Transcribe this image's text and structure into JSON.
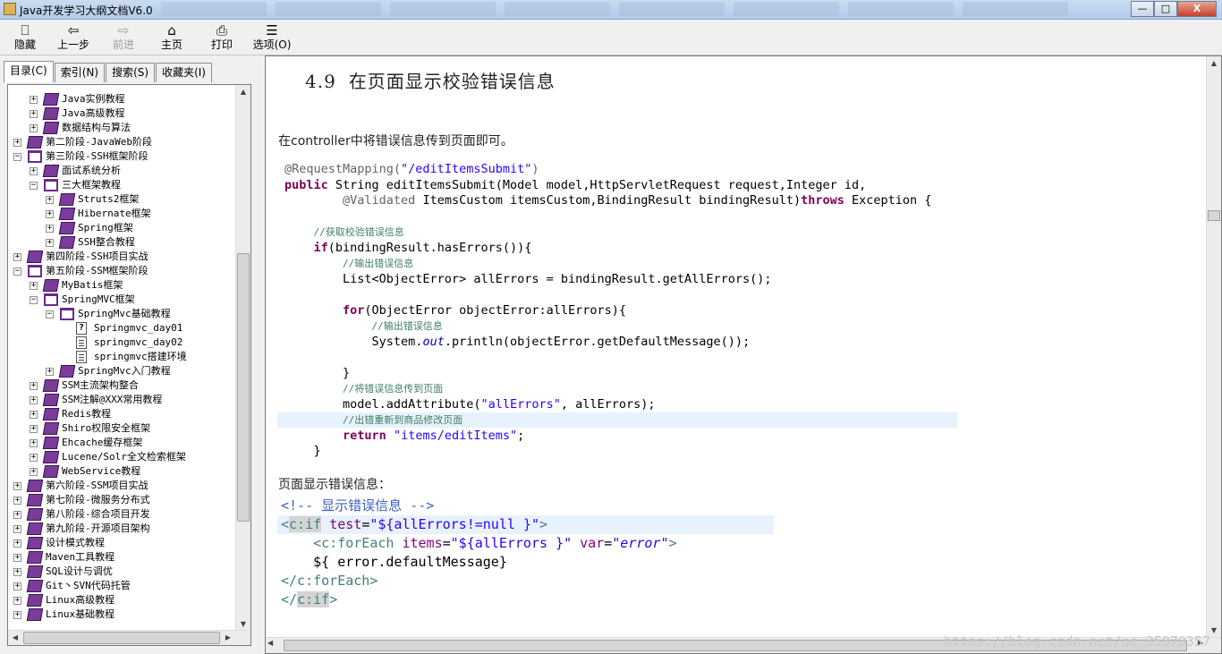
{
  "window": {
    "title": "Java开发学习大纲文档V6.0",
    "buttons": {
      "minimize": "—",
      "maximize": "□",
      "close": "X"
    }
  },
  "toolbar": {
    "items": [
      {
        "label": "隐藏",
        "icon": "hide-icon",
        "glyph": "⎕",
        "enabled": true
      },
      {
        "label": "上一步",
        "icon": "back-arrow-icon",
        "glyph": "⇦",
        "enabled": true
      },
      {
        "label": "前进",
        "icon": "forward-arrow-icon",
        "glyph": "⇨",
        "enabled": false
      },
      {
        "label": "主页",
        "icon": "home-icon",
        "glyph": "⌂",
        "enabled": true
      },
      {
        "label": "打印",
        "icon": "printer-icon",
        "glyph": "⎙",
        "enabled": true
      },
      {
        "label": "选项(O)",
        "icon": "options-icon",
        "glyph": "☰",
        "enabled": true
      }
    ]
  },
  "nav_tabs": [
    {
      "label": "目录(C)",
      "active": true
    },
    {
      "label": "索引(N)",
      "active": false
    },
    {
      "label": "搜索(S)",
      "active": false
    },
    {
      "label": "收藏夹(I)",
      "active": false
    }
  ],
  "tree": [
    {
      "label": "Java实例教程",
      "level": 1,
      "state": "collapsed",
      "icon": "closed-book-icon"
    },
    {
      "label": "Java高级教程",
      "level": 1,
      "state": "collapsed",
      "icon": "closed-book-icon"
    },
    {
      "label": "数据结构与算法",
      "level": 1,
      "state": "collapsed",
      "icon": "closed-book-icon"
    },
    {
      "label": "第二阶段-JavaWeb阶段",
      "level": 0,
      "state": "collapsed",
      "icon": "closed-book-icon"
    },
    {
      "label": "第三阶段-SSH框架阶段",
      "level": 0,
      "state": "expanded",
      "icon": "open-book-icon"
    },
    {
      "label": "面试系统分析",
      "level": 1,
      "state": "collapsed",
      "icon": "closed-book-icon"
    },
    {
      "label": "三大框架教程",
      "level": 1,
      "state": "expanded",
      "icon": "open-book-icon"
    },
    {
      "label": "Struts2框架",
      "level": 2,
      "state": "collapsed",
      "icon": "closed-book-icon"
    },
    {
      "label": "Hibernate框架",
      "level": 2,
      "state": "collapsed",
      "icon": "closed-book-icon"
    },
    {
      "label": "Spring框架",
      "level": 2,
      "state": "collapsed",
      "icon": "closed-book-icon"
    },
    {
      "label": "SSH整合教程",
      "level": 2,
      "state": "collapsed",
      "icon": "closed-book-icon"
    },
    {
      "label": "第四阶段-SSH项目实战",
      "level": 0,
      "state": "collapsed",
      "icon": "closed-book-icon"
    },
    {
      "label": "第五阶段-SSM框架阶段",
      "level": 0,
      "state": "expanded",
      "icon": "open-book-icon"
    },
    {
      "label": "MyBatis框架",
      "level": 1,
      "state": "collapsed",
      "icon": "closed-book-icon"
    },
    {
      "label": "SpringMVC框架",
      "level": 1,
      "state": "expanded",
      "icon": "open-book-icon"
    },
    {
      "label": "SpringMvc基础教程",
      "level": 2,
      "state": "expanded",
      "icon": "open-book-icon"
    },
    {
      "label": "Springmvc_day01",
      "level": 3,
      "state": "leaf",
      "icon": "help-page-icon"
    },
    {
      "label": "springmvc_day02",
      "level": 3,
      "state": "leaf",
      "icon": "page-icon"
    },
    {
      "label": "springmvc搭建环境",
      "level": 3,
      "state": "leaf",
      "icon": "page-icon"
    },
    {
      "label": "SpringMvc入门教程",
      "level": 2,
      "state": "collapsed",
      "icon": "closed-book-icon"
    },
    {
      "label": "SSM主流架构整合",
      "level": 1,
      "state": "collapsed",
      "icon": "closed-book-icon"
    },
    {
      "label": "SSM注解@XXX常用教程",
      "level": 1,
      "state": "collapsed",
      "icon": "closed-book-icon"
    },
    {
      "label": "Redis教程",
      "level": 1,
      "state": "collapsed",
      "icon": "closed-book-icon"
    },
    {
      "label": "Shiro权限安全框架",
      "level": 1,
      "state": "collapsed",
      "icon": "closed-book-icon"
    },
    {
      "label": "Ehcache缓存框架",
      "level": 1,
      "state": "collapsed",
      "icon": "closed-book-icon"
    },
    {
      "label": "Lucene/Solr全文检索框架",
      "level": 1,
      "state": "collapsed",
      "icon": "closed-book-icon"
    },
    {
      "label": "WebService教程",
      "level": 1,
      "state": "collapsed",
      "icon": "closed-book-icon"
    },
    {
      "label": "第六阶段-SSM项目实战",
      "level": 0,
      "state": "collapsed",
      "icon": "closed-book-icon"
    },
    {
      "label": "第七阶段-微服务分布式",
      "level": 0,
      "state": "collapsed",
      "icon": "closed-book-icon"
    },
    {
      "label": "第八阶段-综合项目开发",
      "level": 0,
      "state": "collapsed",
      "icon": "closed-book-icon"
    },
    {
      "label": "第九阶段-开源项目架构",
      "level": 0,
      "state": "collapsed",
      "icon": "closed-book-icon"
    },
    {
      "label": "设计模式教程",
      "level": 0,
      "state": "collapsed",
      "icon": "closed-book-icon"
    },
    {
      "label": "Maven工具教程",
      "level": 0,
      "state": "collapsed",
      "icon": "closed-book-icon"
    },
    {
      "label": "SQL设计与调优",
      "level": 0,
      "state": "collapsed",
      "icon": "closed-book-icon"
    },
    {
      "label": "Git丶SVN代码托管",
      "level": 0,
      "state": "collapsed",
      "icon": "closed-book-icon"
    },
    {
      "label": "Linux高级教程",
      "level": 0,
      "state": "collapsed",
      "icon": "closed-book-icon"
    },
    {
      "label": "Linux基础教程",
      "level": 0,
      "state": "collapsed",
      "icon": "closed-book-icon"
    }
  ],
  "article": {
    "section_number": "4.9",
    "section_title": "在页面显示校验错误信息",
    "intro": "在controller中将错误信息传到页面即可。",
    "java_code": [
      [
        {
          "t": "@RequestMapping(",
          "c": "ann"
        },
        {
          "t": "\"/editItemsSubmit\"",
          "c": "str"
        },
        {
          "t": ")",
          "c": "ann"
        }
      ],
      [
        {
          "t": "public",
          "c": "kw"
        },
        {
          "t": " String editItemsSubmit(Model model,HttpServletRequest request,Integer id,",
          "c": ""
        }
      ],
      [
        {
          "t": "        ",
          "c": ""
        },
        {
          "t": "@Validated",
          "c": "ann"
        },
        {
          "t": " ItemsCustom itemsCustom,BindingResult bindingResult)",
          "c": ""
        },
        {
          "t": "throws",
          "c": "kw"
        },
        {
          "t": " Exception {",
          "c": ""
        }
      ],
      [],
      [
        {
          "t": "    ",
          "c": ""
        },
        {
          "t": "//获取校验错误信息",
          "c": "cmt"
        }
      ],
      [
        {
          "t": "    ",
          "c": ""
        },
        {
          "t": "if",
          "c": "kw"
        },
        {
          "t": "(bindingResult.hasErrors()){",
          "c": ""
        }
      ],
      [
        {
          "t": "        ",
          "c": ""
        },
        {
          "t": "//输出错误信息",
          "c": "cmt"
        }
      ],
      [
        {
          "t": "        List<ObjectError> allErrors = bindingResult.getAllErrors();",
          "c": ""
        }
      ],
      [],
      [
        {
          "t": "        ",
          "c": ""
        },
        {
          "t": "for",
          "c": "kw"
        },
        {
          "t": "(ObjectError objectError:allErrors){",
          "c": ""
        }
      ],
      [
        {
          "t": "            ",
          "c": ""
        },
        {
          "t": "//输出错误信息",
          "c": "cmt"
        }
      ],
      [
        {
          "t": "            System.",
          "c": ""
        },
        {
          "t": "out",
          "c": "it"
        },
        {
          "t": ".println(objectError.getDefaultMessage());",
          "c": ""
        }
      ],
      [],
      [
        {
          "t": "        }",
          "c": ""
        }
      ],
      [
        {
          "t": "        ",
          "c": ""
        },
        {
          "t": "//将错误信息传到页面",
          "c": "cmt"
        }
      ],
      [
        {
          "t": "        model.addAttribute(",
          "c": ""
        },
        {
          "t": "\"allErrors\"",
          "c": "str"
        },
        {
          "t": ", allErrors);",
          "c": ""
        }
      ],
      [
        {
          "t": "        ",
          "c": ""
        },
        {
          "t": "//出错重新到商品修改页面",
          "c": "cmt"
        }
      ],
      [
        {
          "t": "        ",
          "c": ""
        },
        {
          "t": "return",
          "c": "kw"
        },
        {
          "t": " ",
          "c": ""
        },
        {
          "t": "\"items/editItems\"",
          "c": "str"
        },
        {
          "t": ";",
          "c": ""
        }
      ],
      [
        {
          "t": "    }",
          "c": ""
        }
      ]
    ],
    "page_error_label": "页面显示错误信息：",
    "jsp_code": [
      [
        {
          "t": "<!-- 显示错误信息 -->",
          "c": "acmt"
        }
      ],
      [
        {
          "t": "<",
          "c": "tag"
        },
        {
          "t": "c:if",
          "c": "tagn"
        },
        {
          "t": " ",
          "c": ""
        },
        {
          "t": "test",
          "c": "attr"
        },
        {
          "t": "=",
          "c": ""
        },
        {
          "t": "\"${allErrors!=null }\"",
          "c": "aval"
        },
        {
          "t": ">",
          "c": "tag"
        }
      ],
      [
        {
          "t": "    <c:forEach ",
          "c": "tag"
        },
        {
          "t": "items",
          "c": "attr"
        },
        {
          "t": "=",
          "c": ""
        },
        {
          "t": "\"${allErrors }\"",
          "c": "aval"
        },
        {
          "t": " ",
          "c": ""
        },
        {
          "t": "var",
          "c": "attr"
        },
        {
          "t": "=",
          "c": ""
        },
        {
          "t": "\"error\"",
          "c": "aval it"
        },
        {
          "t": ">",
          "c": "tag"
        }
      ],
      [
        {
          "t": "    ${ error.defaultMessage}",
          "c": ""
        }
      ],
      [
        {
          "t": "</c:forEach>",
          "c": "tag"
        }
      ],
      [
        {
          "t": "</",
          "c": "tag"
        },
        {
          "t": "c:if",
          "c": "tagn"
        },
        {
          "t": ">",
          "c": "tag"
        }
      ]
    ]
  },
  "watermark": "https://blog.csdn.net/qq_35070357"
}
